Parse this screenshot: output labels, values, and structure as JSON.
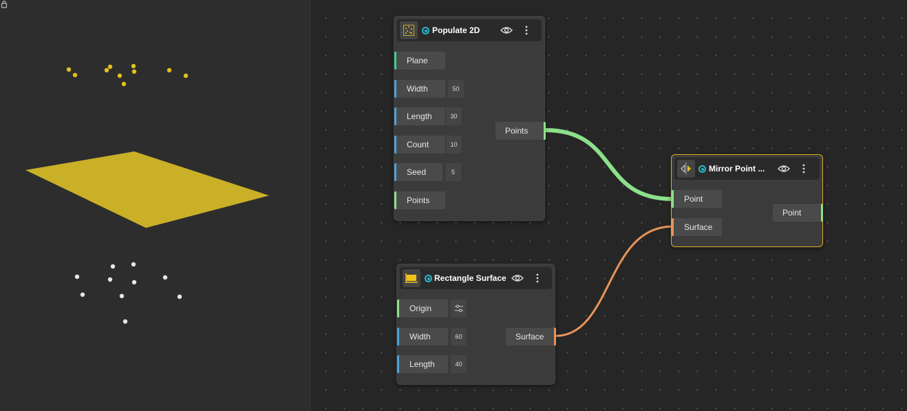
{
  "colors": {
    "accent_selected": "#e0b02a",
    "status_dot": "#29b6c8",
    "wire_points": "#8de08a",
    "wire_surface": "#e8935a",
    "surface_fill": "#c9b027",
    "points_yellow": "#e2c21c",
    "points_white": "#e6e6e6"
  },
  "nodes": {
    "populate2d": {
      "title": "Populate 2D",
      "inputs": [
        {
          "label": "Plane"
        },
        {
          "label": "Width",
          "value": "50"
        },
        {
          "label": "Length",
          "value": "30"
        },
        {
          "label": "Count",
          "value": "10"
        },
        {
          "label": "Seed",
          "value": "5"
        },
        {
          "label": "Points"
        }
      ],
      "output": "Points"
    },
    "rectangle_surface": {
      "title": "Rectangle Surface",
      "inputs": [
        {
          "label": "Origin"
        },
        {
          "label": "Width",
          "value": "60"
        },
        {
          "label": "Length",
          "value": "40"
        }
      ],
      "output": "Surface"
    },
    "mirror_point": {
      "title": "Mirror Point ...",
      "inputs": [
        {
          "label": "Point"
        },
        {
          "label": "Surface"
        }
      ],
      "output": "Point"
    }
  },
  "icons": {
    "populate2d": "scatter-points-icon",
    "rectangle_surface": "rectangle-icon",
    "mirror_point": "mirror-icon",
    "eye": "eye-icon",
    "menu": "kebab-menu-icon",
    "settings": "sliders-icon",
    "viewport_lock": "lock-icon"
  }
}
